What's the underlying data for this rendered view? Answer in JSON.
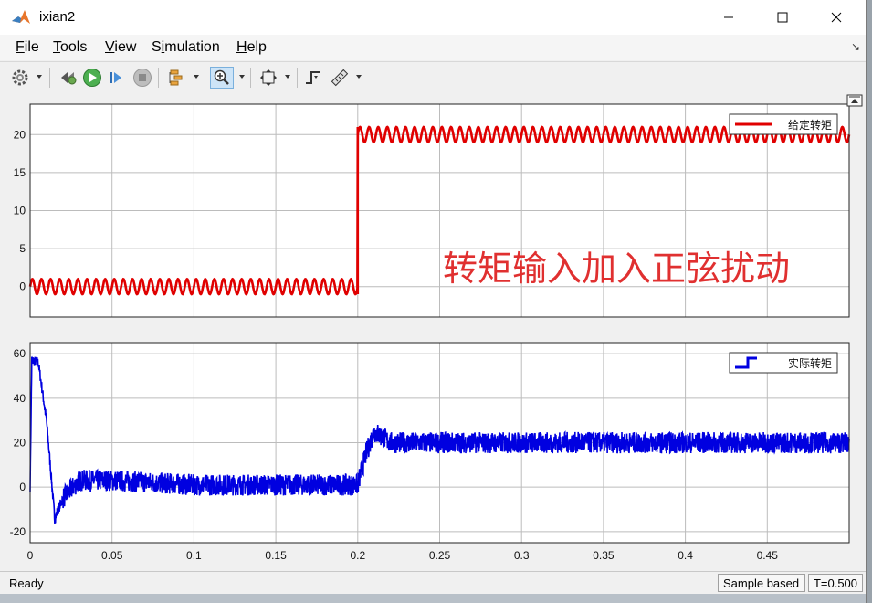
{
  "window": {
    "title": "ixian2",
    "buttons": {
      "minimize": "minimize-icon",
      "maximize": "maximize-icon",
      "close": "close-icon"
    }
  },
  "menu": [
    {
      "label": "File",
      "key": "F"
    },
    {
      "label": "Tools",
      "key": "T"
    },
    {
      "label": "View",
      "key": "V"
    },
    {
      "label": "Simulation",
      "key": "i"
    },
    {
      "label": "Help",
      "key": "H"
    }
  ],
  "toolbar": [
    "parameters-icon",
    "restore-icon",
    "run-icon",
    "step-forward-icon",
    "stop-icon",
    "highlight-icon",
    "zoom-icon",
    "autoscale-icon",
    "triggers-icon",
    "cursor-measurements-icon"
  ],
  "annotation": "转矩输入加入正弦扰动",
  "status": {
    "text": "Ready",
    "sample_mode": "Sample based",
    "time": "T=0.500"
  },
  "colors": {
    "series1": "#e00000",
    "series2": "#0000e0",
    "annotation": "#e03030",
    "grid": "#bcbcbc"
  },
  "chart_data": [
    {
      "type": "line",
      "xlim": [
        0,
        0.5
      ],
      "ylim": [
        -4,
        24
      ],
      "xticks": [],
      "yticks": [
        0,
        5,
        10,
        15,
        20
      ],
      "legend": {
        "placement": "top-right",
        "entries": [
          "给定转矩"
        ]
      },
      "series": [
        {
          "name": "给定转矩",
          "description": "step with sinusoidal ripple",
          "step_time": 0.2,
          "before": 0,
          "after": 20,
          "ripple_amplitude": 1,
          "ripple_cycles_per_0_1s": 18
        }
      ]
    },
    {
      "type": "line",
      "xlim": [
        0,
        0.5
      ],
      "ylim": [
        -25,
        65
      ],
      "xticks": [
        0,
        0.05,
        0.1,
        0.15,
        0.2,
        0.25,
        0.3,
        0.35,
        0.4,
        0.45
      ],
      "yticks": [
        -20,
        0,
        20,
        40,
        60
      ],
      "legend": {
        "placement": "top-right",
        "entries": [
          "实际转矩"
        ]
      },
      "series": [
        {
          "name": "实际转矩",
          "key_points": [
            [
              0,
              0
            ],
            [
              0.001,
              57
            ],
            [
              0.005,
              56
            ],
            [
              0.01,
              30
            ],
            [
              0.015,
              -14
            ],
            [
              0.02,
              -5
            ],
            [
              0.03,
              3
            ],
            [
              0.05,
              3
            ],
            [
              0.1,
              1
            ],
            [
              0.2,
              1
            ],
            [
              0.205,
              15
            ],
            [
              0.21,
              25
            ],
            [
              0.22,
              20
            ],
            [
              0.5,
              20
            ]
          ],
          "noise_band": 6
        }
      ]
    }
  ]
}
